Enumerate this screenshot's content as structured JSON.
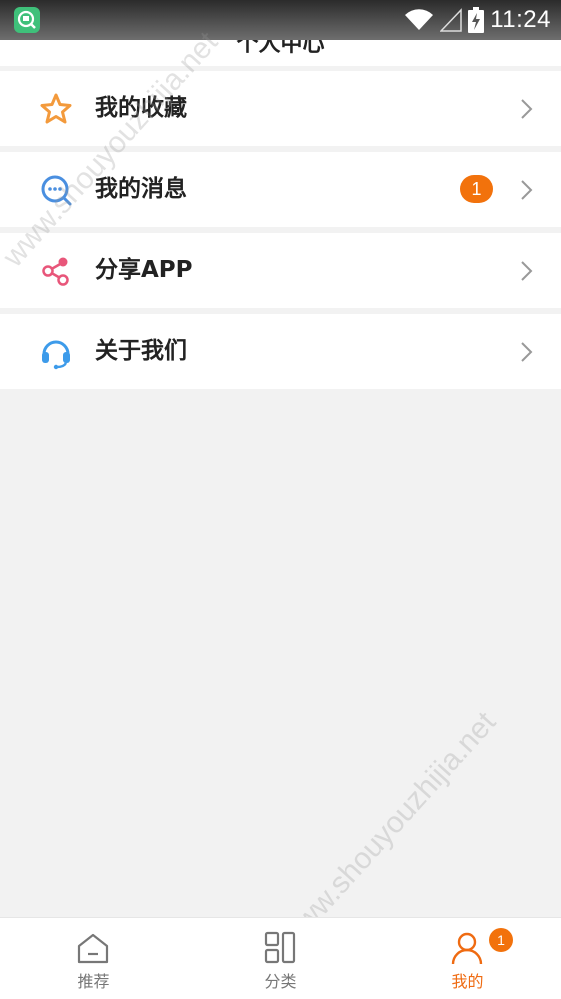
{
  "status_bar": {
    "time": "11:24"
  },
  "header": {
    "title": "个人中心"
  },
  "menu": {
    "items": [
      {
        "label": "我的收藏",
        "icon": "star-icon"
      },
      {
        "label": "我的消息",
        "icon": "message-icon",
        "badge": "1"
      },
      {
        "label": "分享APP",
        "icon": "share-icon"
      },
      {
        "label": "关于我们",
        "icon": "headset-icon"
      }
    ]
  },
  "bottom_nav": {
    "tabs": [
      {
        "label": "推荐",
        "icon": "home-icon"
      },
      {
        "label": "分类",
        "icon": "grid-icon"
      },
      {
        "label": "我的",
        "icon": "user-icon",
        "badge": "1",
        "active": true
      }
    ]
  },
  "watermark": {
    "text": "www.shouyouzhijia.net"
  },
  "colors": {
    "accent": "#ef6b12",
    "badge": "#f2720c",
    "background": "#f2f2f2"
  }
}
